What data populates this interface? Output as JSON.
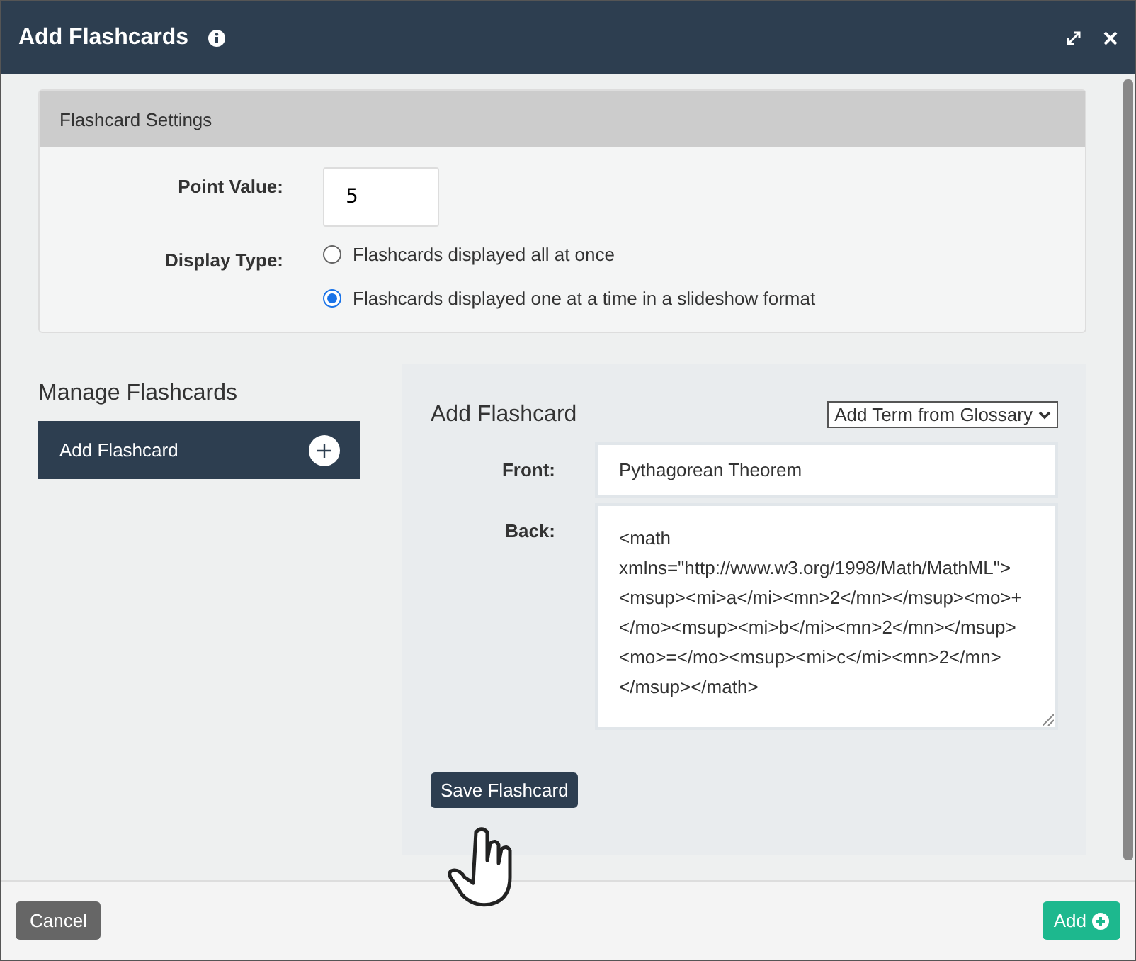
{
  "window": {
    "title": "Add Flashcards"
  },
  "settings": {
    "title": "Flashcard Settings",
    "point_value_label": "Point Value:",
    "point_value": "5",
    "display_type_label": "Display Type:",
    "display_options": [
      {
        "label": "Flashcards displayed all at once",
        "selected": false
      },
      {
        "label": "Flashcards displayed one at a time in a slideshow format",
        "selected": true
      }
    ]
  },
  "manage": {
    "title": "Manage Flashcards",
    "items": [
      {
        "label": "Add Flashcard",
        "selected": true
      }
    ]
  },
  "editor": {
    "title": "Add Flashcard",
    "glossary_select": "Add Term from Glossary",
    "front_label": "Front:",
    "front_value": "Pythagorean Theorem",
    "back_label": "Back:",
    "back_value": "<math xmlns=\"http://www.w3.org/1998/Math/MathML\"><msup><mi>a</mi><mn>2</mn></msup><mo>+</mo><msup><mi>b</mi><mn>2</mn></msup><mo>=</mo><msup><mi>c</mi><mn>2</mn></msup></math>",
    "save_button": "Save Flashcard"
  },
  "footer": {
    "cancel": "Cancel",
    "add": "Add"
  }
}
